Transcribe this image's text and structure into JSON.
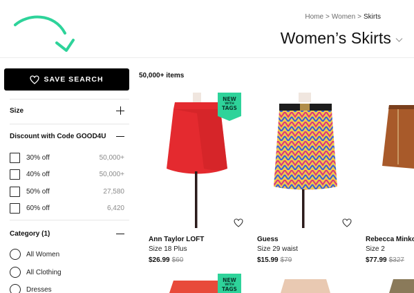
{
  "breadcrumb": {
    "items": [
      "Home",
      "Women",
      "Skirts"
    ],
    "separator": ">"
  },
  "page": {
    "title": "Women’s Skirts"
  },
  "sidebar": {
    "save_search_label": "SAVE SEARCH",
    "size_label": "Size",
    "discount_label": "Discount with Code GOOD4U",
    "discount_options": [
      {
        "label": "30% off",
        "count": "50,000+"
      },
      {
        "label": "40% off",
        "count": "50,000+"
      },
      {
        "label": "50% off",
        "count": "27,580"
      },
      {
        "label": "60% off",
        "count": "6,420"
      }
    ],
    "category_label": "Category (1)",
    "category_options": [
      "All Women",
      "All Clothing",
      "Dresses"
    ]
  },
  "results": {
    "count_label": "50,000+ items",
    "new_tag": {
      "line1": "NEW",
      "line2": "WITH",
      "line3": "TAGS"
    },
    "products": [
      {
        "brand": "Ann Taylor LOFT",
        "size": "Size 18 Plus",
        "price": "$26.99",
        "original_price": "$60",
        "new_with_tags": true,
        "color": "#e42a2f"
      },
      {
        "brand": "Guess",
        "size": "Size 29 waist",
        "price": "$15.99",
        "original_price": "$79",
        "new_with_tags": false,
        "color": "#c43c5a"
      },
      {
        "brand": "Rebecca Minkoff",
        "size": "Size 2",
        "price": "$77.99",
        "original_price": "$327",
        "new_with_tags": false,
        "color": "#a85a2a"
      }
    ]
  },
  "colors": {
    "accent_teal": "#2ed39a",
    "button_bg": "#000000"
  },
  "icons": [
    "curved-arrow-icon",
    "heart-icon",
    "chevron-down-icon",
    "plus-icon",
    "minus-icon"
  ]
}
